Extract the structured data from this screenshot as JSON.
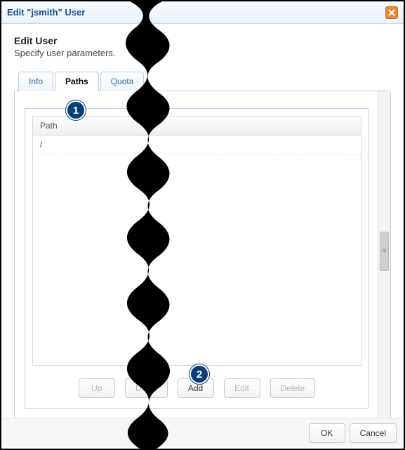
{
  "dialog": {
    "title": "Edit \"jsmith\" User"
  },
  "header": {
    "heading": "Edit User",
    "subheading": "Specify user parameters."
  },
  "tabs": {
    "info": "Info",
    "paths": "Paths",
    "quota": "Quota"
  },
  "paths_table": {
    "header": "Path",
    "rows": [
      "/"
    ]
  },
  "buttons": {
    "up": "Up",
    "down": "Down",
    "add": "Add",
    "edit": "Edit",
    "delete": "Delete",
    "ok": "OK",
    "cancel": "Cancel"
  },
  "callouts": {
    "one": "1",
    "two": "2"
  }
}
